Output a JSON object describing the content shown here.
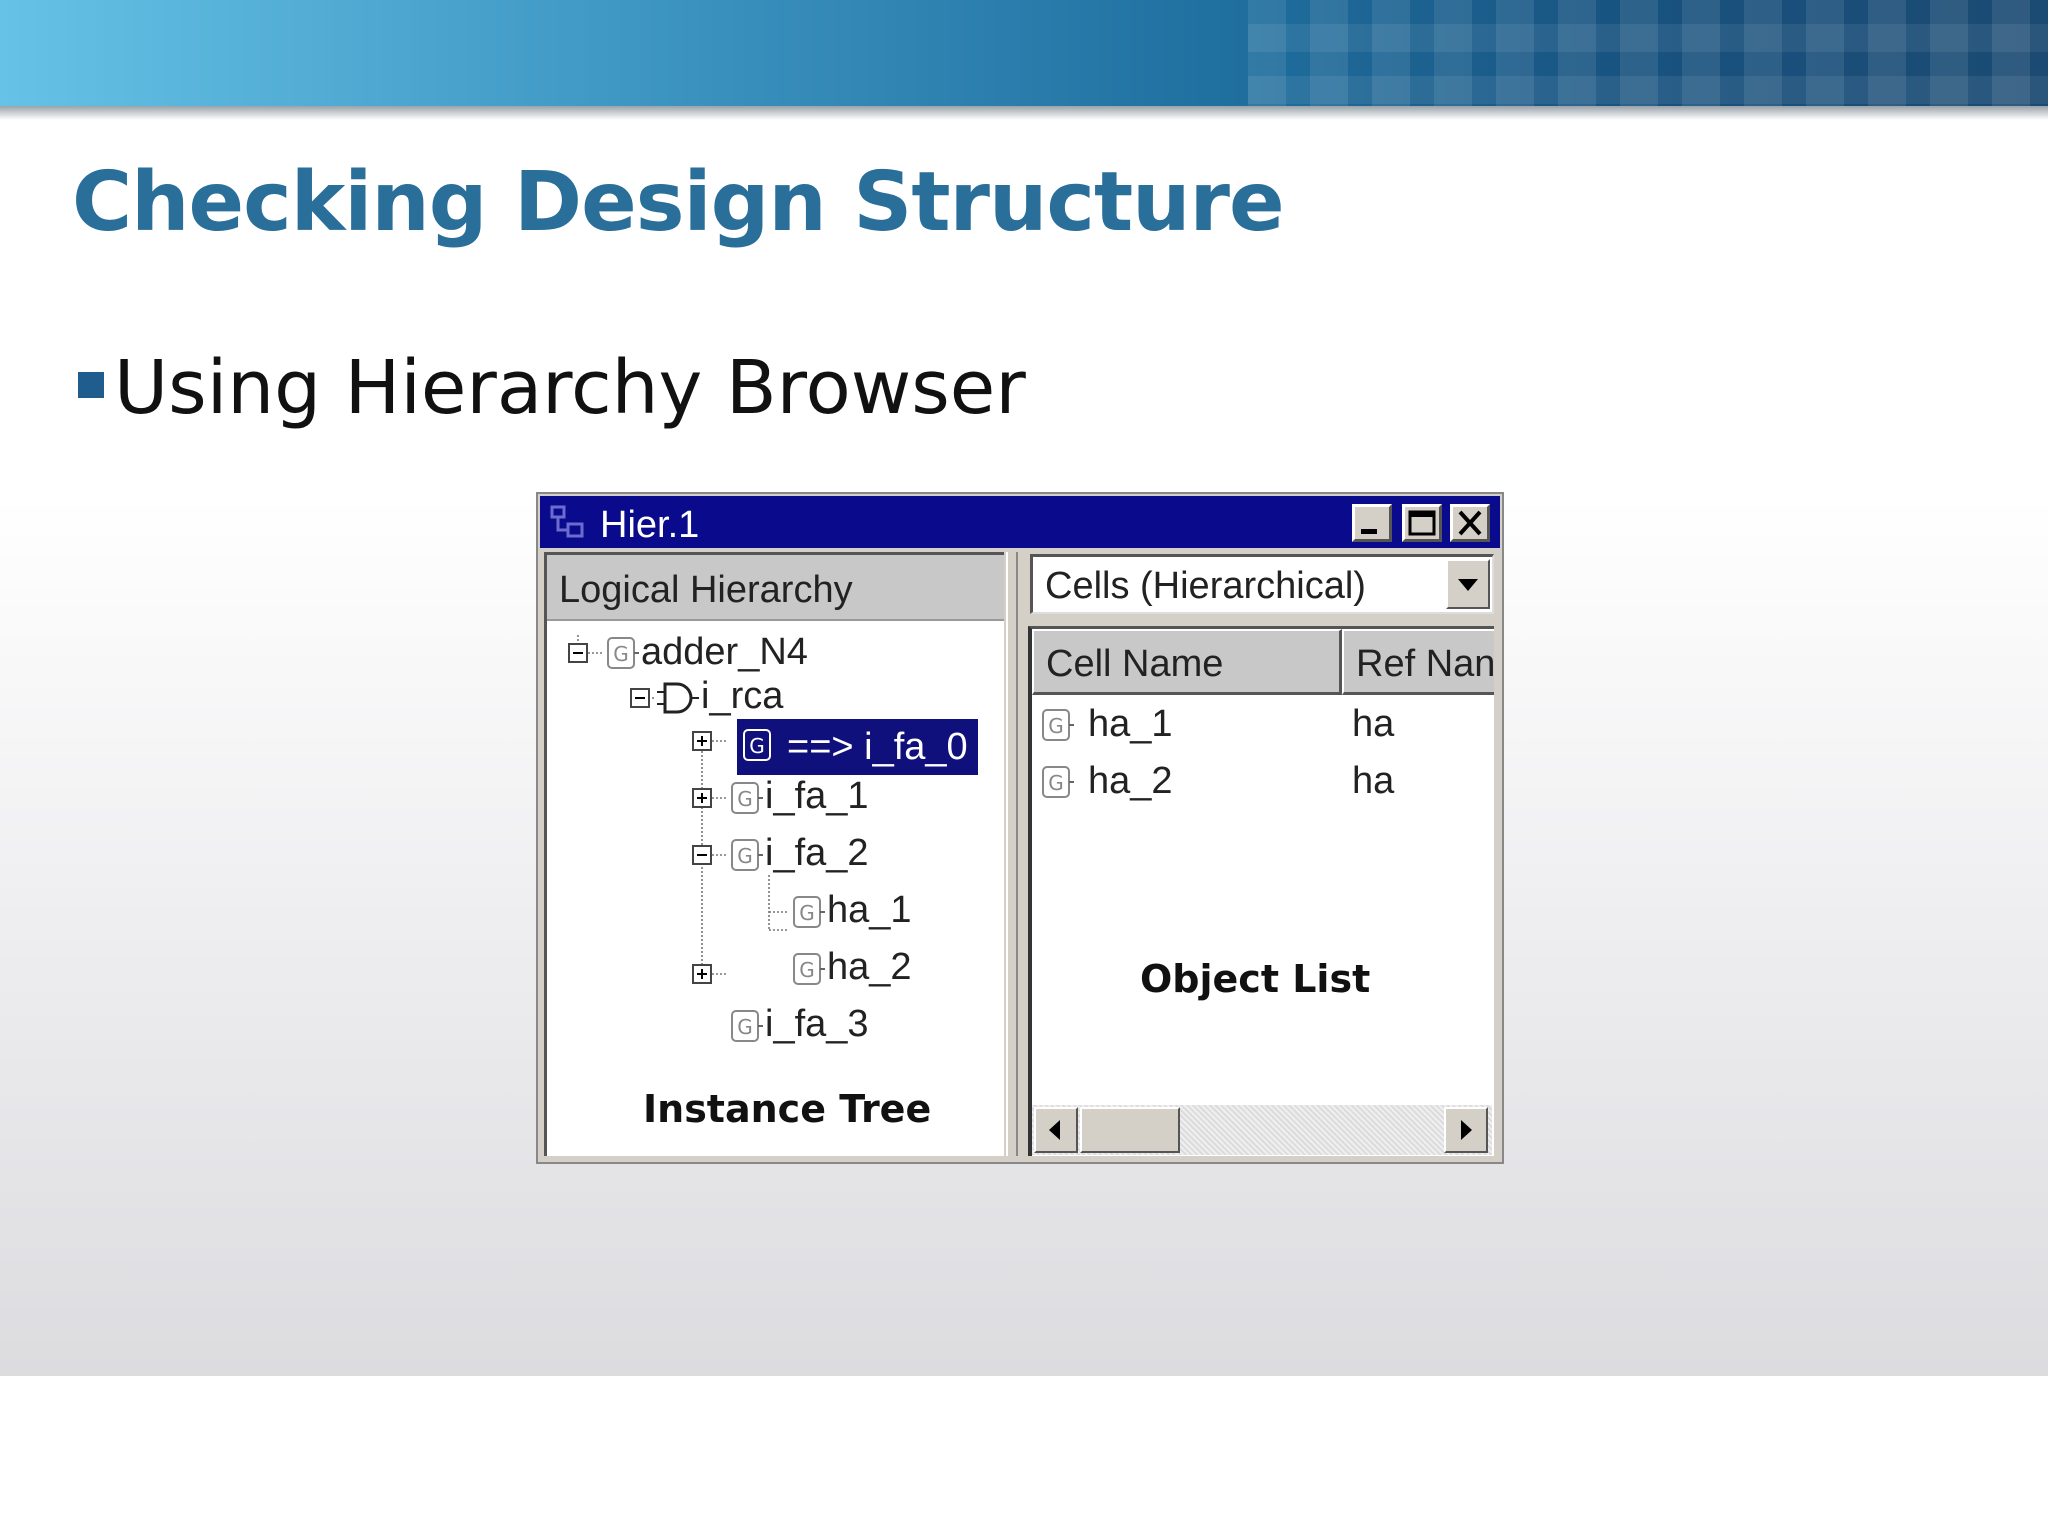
{
  "slide": {
    "title": "Checking Design Structure",
    "bullet": "Using Hierarchy Browser"
  },
  "window": {
    "title": "Hier.1",
    "left_pane": {
      "header": "Logical Hierarchy",
      "caption": "Instance Tree",
      "tree": [
        {
          "label": "adder_N4",
          "icon": "gate-g-icon",
          "expander": "minus",
          "level": 0
        },
        {
          "label": "i_rca",
          "icon": "and-gate-icon",
          "expander": "minus",
          "level": 1
        },
        {
          "label": "==> i_fa_0",
          "icon": "gate-g-icon",
          "expander": "plus",
          "level": 2,
          "selected": true
        },
        {
          "label": "i_fa_1",
          "icon": "gate-g-icon",
          "expander": "plus",
          "level": 2
        },
        {
          "label": "i_fa_2",
          "icon": "gate-g-icon",
          "expander": "minus",
          "level": 2
        },
        {
          "label": "ha_1",
          "icon": "gate-g-icon",
          "expander": "none",
          "level": 3
        },
        {
          "label": "ha_2",
          "icon": "gate-g-icon",
          "expander": "none",
          "level": 3
        },
        {
          "label": "i_fa_3",
          "icon": "gate-g-icon",
          "expander": "plus",
          "level": 2
        }
      ]
    },
    "right_pane": {
      "dropdown_value": "Cells (Hierarchical)",
      "columns": [
        "Cell Name",
        "Ref Nan"
      ],
      "rows": [
        {
          "cell_name": "ha_1",
          "ref_name": "ha"
        },
        {
          "cell_name": "ha_2",
          "ref_name": "ha"
        }
      ],
      "caption": "Object List"
    }
  },
  "colors": {
    "title_blue": "#2a6e9a",
    "titlebar": "#0a0a8c",
    "selection": "#10107c"
  }
}
